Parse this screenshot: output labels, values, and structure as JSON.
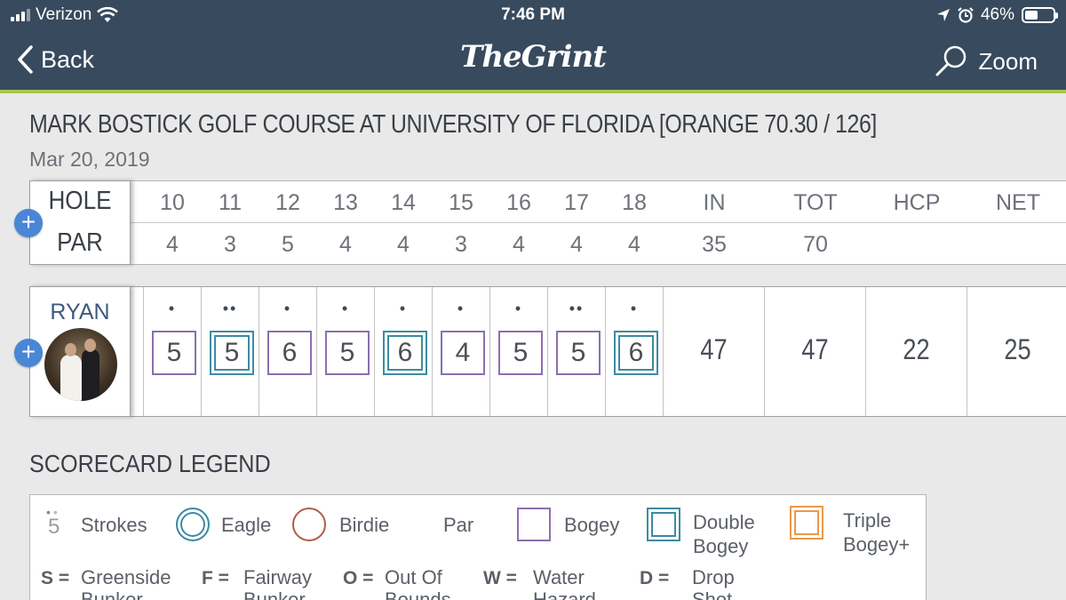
{
  "status_bar": {
    "carrier": "Verizon",
    "time": "7:46 PM",
    "battery": "46%",
    "battery_level": 0.46
  },
  "nav": {
    "back_label": "Back",
    "logo": "TheGrint",
    "zoom_label": "Zoom"
  },
  "course": {
    "title": "MARK BOSTICK GOLF COURSE AT UNIVERSITY OF FLORIDA [ORANGE 70.30 / 126]",
    "date": "Mar 20, 2019"
  },
  "scorecard": {
    "hole_label": "HOLE",
    "par_label": "PAR",
    "holes": [
      "10",
      "11",
      "12",
      "13",
      "14",
      "15",
      "16",
      "17",
      "18"
    ],
    "pars": [
      "4",
      "3",
      "5",
      "4",
      "4",
      "3",
      "4",
      "4",
      "4"
    ],
    "summary_headers": [
      "IN",
      "TOT",
      "HCP",
      "NET"
    ],
    "summary_pars": [
      "35",
      "70",
      "",
      ""
    ]
  },
  "player": {
    "name": "RYAN",
    "scores": [
      {
        "strokes": "5",
        "dots": "•",
        "result": "bogey"
      },
      {
        "strokes": "5",
        "dots": "••",
        "result": "double"
      },
      {
        "strokes": "6",
        "dots": "•",
        "result": "bogey"
      },
      {
        "strokes": "5",
        "dots": "•",
        "result": "bogey"
      },
      {
        "strokes": "6",
        "dots": "•",
        "result": "double"
      },
      {
        "strokes": "4",
        "dots": "•",
        "result": "bogey"
      },
      {
        "strokes": "5",
        "dots": "•",
        "result": "bogey"
      },
      {
        "strokes": "5",
        "dots": "••",
        "result": "bogey"
      },
      {
        "strokes": "6",
        "dots": "•",
        "result": "double"
      }
    ],
    "totals": [
      "47",
      "47",
      "22",
      "25"
    ]
  },
  "legend": {
    "title": "SCORECARD LEGEND",
    "sample_stroke": "5",
    "strokes": "Strokes",
    "eagle": "Eagle",
    "birdie": "Birdie",
    "par": "Par",
    "bogey": "Bogey",
    "double_bogey_1": "Double",
    "double_bogey_2": "Bogey",
    "triple_bogey_1": "Triple",
    "triple_bogey_2": "Bogey+",
    "keys": [
      {
        "key": "S =",
        "line1": "Greenside",
        "line2": "Bunker"
      },
      {
        "key": "F =",
        "line1": "Fairway",
        "line2": "Bunker"
      },
      {
        "key": "O =",
        "line1": "Out Of",
        "line2": "Bounds"
      },
      {
        "key": "W =",
        "line1": "Water",
        "line2": "Hazard"
      },
      {
        "key": "D =",
        "line1": "Drop",
        "line2": "Shot"
      }
    ]
  },
  "colors": {
    "header": "#384a5e",
    "accent": "#a8c64f",
    "bogey": "#8b6fb0",
    "double": "#3d8ba1",
    "eagle": "#3d8ba1",
    "birdie": "#b35a4e",
    "triple": "#e89a4a",
    "plus": "#4a86d6"
  }
}
